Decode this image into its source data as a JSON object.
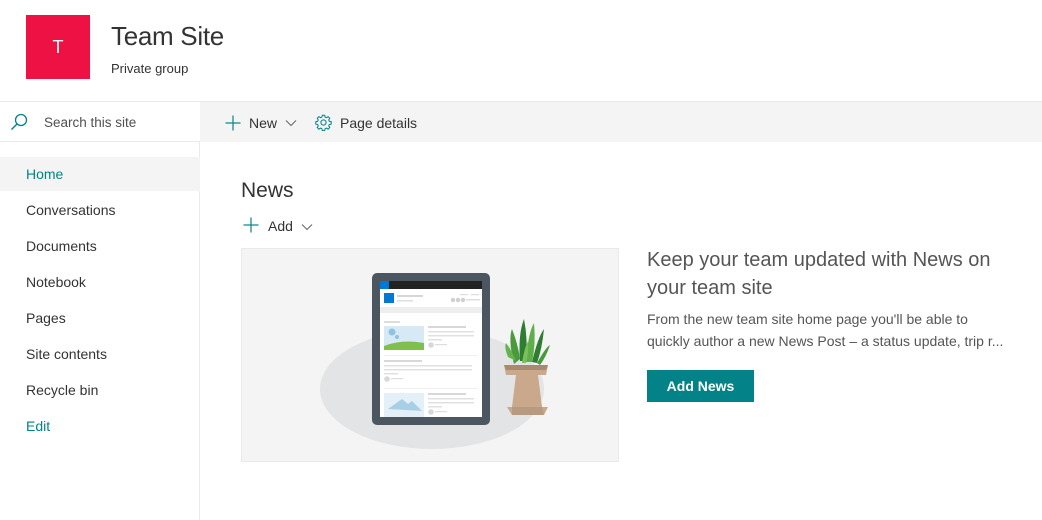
{
  "header": {
    "logo_letter": "T",
    "logo_color": "#ee1144",
    "title": "Team Site",
    "subtitle": "Private group"
  },
  "search": {
    "icon": "search-icon",
    "placeholder": "Search this site"
  },
  "commandbar": {
    "new_label": "New",
    "new_icon": "plus-icon",
    "page_details_label": "Page details",
    "page_details_icon": "gear-icon"
  },
  "sidebar": {
    "items": [
      {
        "label": "Home",
        "active": true
      },
      {
        "label": "Conversations"
      },
      {
        "label": "Documents"
      },
      {
        "label": "Notebook"
      },
      {
        "label": "Pages"
      },
      {
        "label": "Site contents"
      },
      {
        "label": "Recycle bin"
      },
      {
        "label": "Edit",
        "accent": true
      }
    ]
  },
  "news": {
    "title": "News",
    "add_label": "Add",
    "heading": "Keep your team updated with News on your team site",
    "description_line1": "From the new team site home page you'll be able to",
    "description_line2": "quickly author a new News Post – a status update, trip r...",
    "button_label": "Add News"
  },
  "colors": {
    "accent": "#038387",
    "logo": "#ee1144",
    "commandbar_bg": "#f4f4f4"
  }
}
